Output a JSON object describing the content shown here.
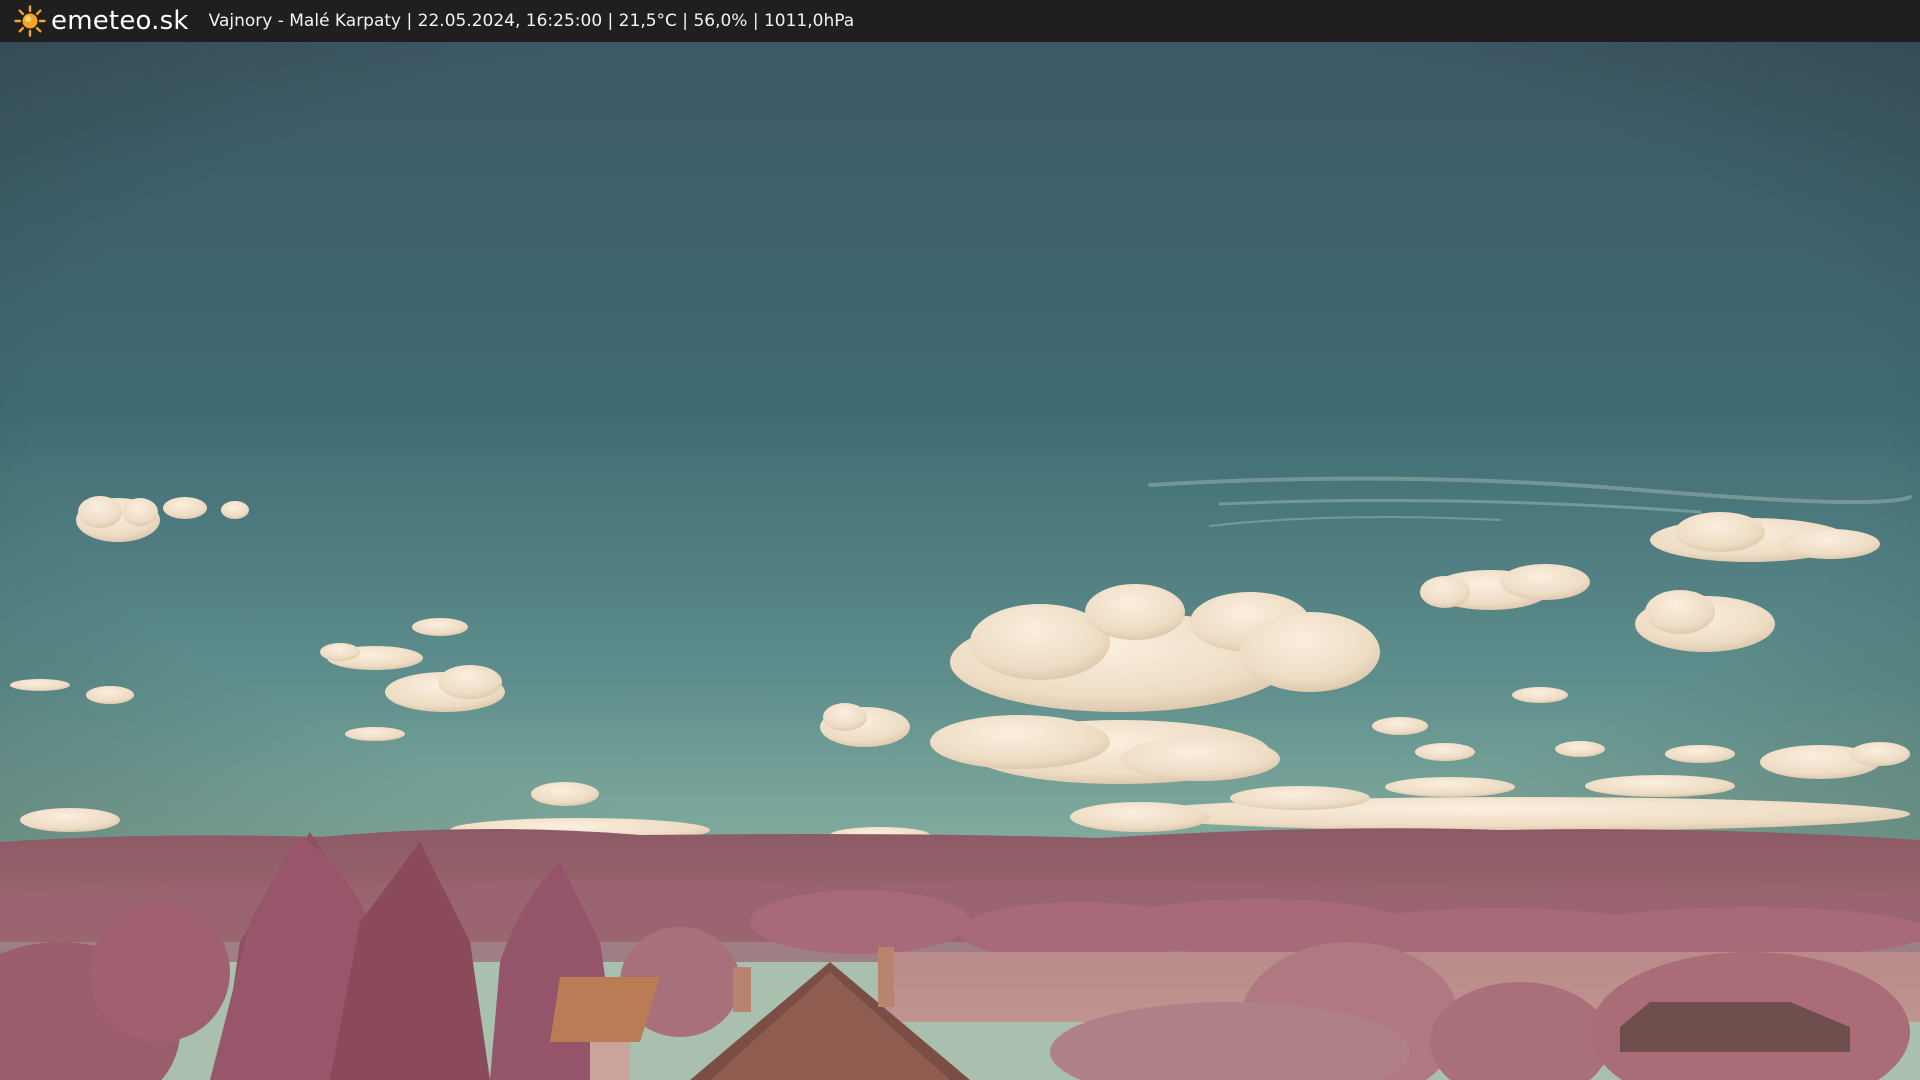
{
  "header": {
    "brand": "emeteo.sk",
    "brand_icon": "sun-icon",
    "caption": "Vajnory - Malé Karpaty | 22.05.2024, 16:25:00 | 21,5°C | 56,0% | 1011,0hPa"
  },
  "colors": {
    "bar_background": "#1f1f1f",
    "sun": "#f5a623",
    "sky_top": "#3b5864",
    "sky_bottom": "#8db5a8",
    "vegetation": "#a56470"
  }
}
